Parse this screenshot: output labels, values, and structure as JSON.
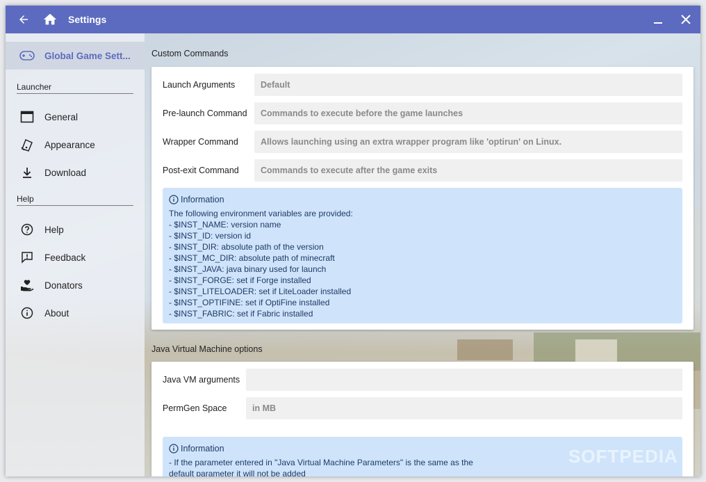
{
  "window": {
    "title": "Settings"
  },
  "sidebar": {
    "selected": {
      "label": "Global Game Sett..."
    },
    "sections": [
      {
        "title": "Launcher",
        "items": [
          {
            "label": "General"
          },
          {
            "label": "Appearance"
          },
          {
            "label": "Download"
          }
        ]
      },
      {
        "title": "Help",
        "items": [
          {
            "label": "Help"
          },
          {
            "label": "Feedback"
          },
          {
            "label": "Donators"
          },
          {
            "label": "About"
          }
        ]
      }
    ]
  },
  "custom_commands": {
    "title": "Custom Commands",
    "rows": [
      {
        "label": "Launch Arguments",
        "placeholder": "Default"
      },
      {
        "label": "Pre-launch Command",
        "placeholder": "Commands to execute before the game launches"
      },
      {
        "label": "Wrapper Command",
        "placeholder": "Allows launching using an extra wrapper program like 'optirun' on Linux."
      },
      {
        "label": "Post-exit Command",
        "placeholder": "Commands to execute after the game exits"
      }
    ],
    "info": {
      "heading": "Information",
      "lines": [
        "The following environment variables are provided:",
        "- $INST_NAME: version name",
        "- $INST_ID: version id",
        "- $INST_DIR: absolute path of the version",
        "- $INST_MC_DIR: absolute path of minecraft",
        "- $INST_JAVA: java binary used for launch",
        "- $INST_FORGE: set if Forge installed",
        "- $INST_LITELOADER: set if LiteLoader installed",
        "- $INST_OPTIFINE: set if OptiFine installed",
        "- $INST_FABRIC: set if Fabric installed"
      ]
    }
  },
  "jvm_options": {
    "title": "Java Virtual Machine options",
    "rows": [
      {
        "label": "Java VM arguments",
        "placeholder": ""
      },
      {
        "label": "PermGen Space",
        "placeholder": "in MB"
      }
    ],
    "info": {
      "heading": "Information",
      "lines": [
        "- If the parameter entered in \"Java Virtual Machine Parameters\" is the same as the",
        "default parameter it will not be added"
      ]
    }
  },
  "watermark": "SOFTPEDIA",
  "colors": {
    "accent": "#5c6bc0",
    "info_bg": "#cfe4fb",
    "info_text": "#1e3a64"
  }
}
